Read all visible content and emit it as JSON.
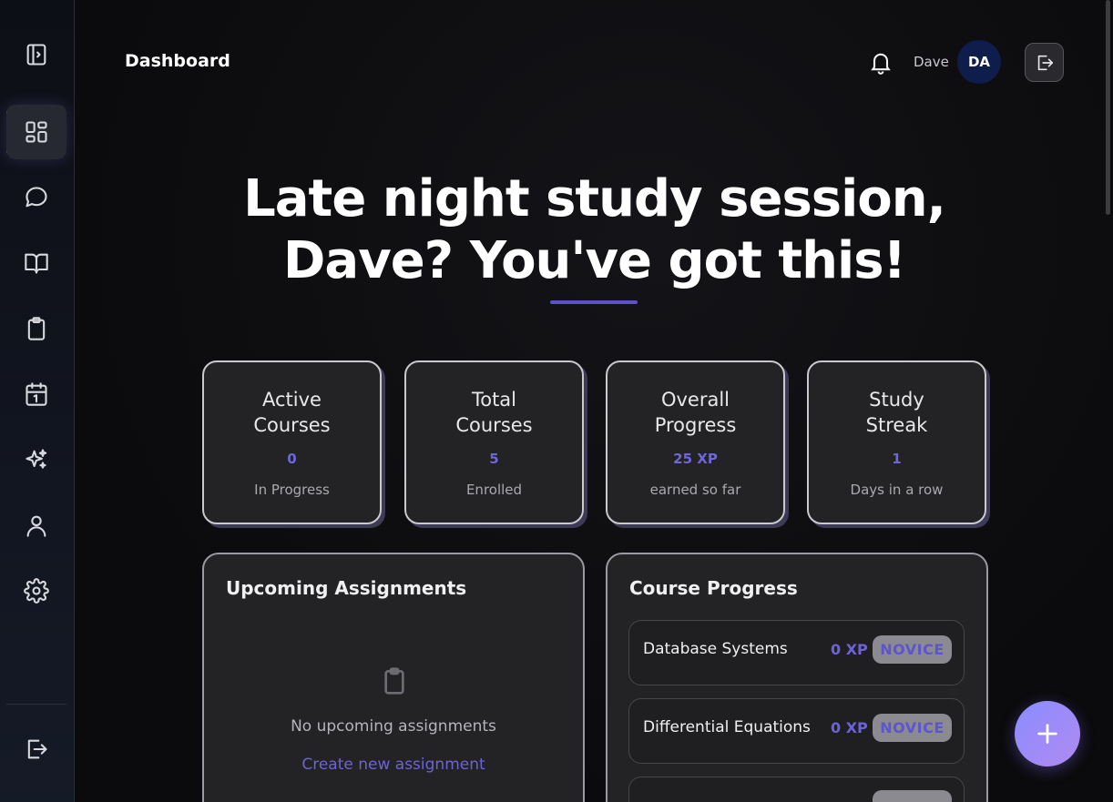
{
  "sidebar": {
    "items": [
      {
        "name": "toggle-sidebar",
        "icon": "panel-toggle-icon"
      },
      {
        "name": "dashboard",
        "icon": "dashboard-grid-icon",
        "active": true
      },
      {
        "name": "chat",
        "icon": "chat-bubble-icon"
      },
      {
        "name": "courses",
        "icon": "open-book-icon"
      },
      {
        "name": "assignments",
        "icon": "clipboard-icon"
      },
      {
        "name": "calendar",
        "icon": "calendar-icon"
      },
      {
        "name": "ai-assistant",
        "icon": "sparkles-icon"
      },
      {
        "name": "profile",
        "icon": "user-icon"
      },
      {
        "name": "settings",
        "icon": "gear-icon"
      },
      {
        "name": "logout",
        "icon": "logout-icon"
      }
    ]
  },
  "header": {
    "title": "Dashboard",
    "user_name": "Dave",
    "avatar_initials": "DA"
  },
  "hero": {
    "line1": "Late night study session,",
    "line2": "Dave? You've got this!"
  },
  "stats": [
    {
      "title": "Active Courses",
      "value": "0",
      "label": "In Progress"
    },
    {
      "title": "Total Courses",
      "value": "5",
      "label": "Enrolled"
    },
    {
      "title": "Overall Progress",
      "value": "25 XP",
      "label": "earned so far"
    },
    {
      "title": "Study Streak",
      "value": "1",
      "label": "Days in a row"
    }
  ],
  "assignments": {
    "title": "Upcoming Assignments",
    "empty_text": "No upcoming assignments",
    "create_link": "Create new assignment"
  },
  "course_progress": {
    "title": "Course Progress",
    "courses": [
      {
        "name": "Database Systems",
        "xp": "0 XP",
        "level": "NOVICE"
      },
      {
        "name": "Differential Equations",
        "xp": "0 XP",
        "level": "NOVICE"
      },
      {
        "name": "",
        "xp": "",
        "level": ""
      }
    ]
  },
  "colors": {
    "accent": "#6d63d8",
    "avatar_bg": "#0f1d4d",
    "fab_gradient_start": "#8a8cff",
    "fab_gradient_end": "#b08af0"
  }
}
